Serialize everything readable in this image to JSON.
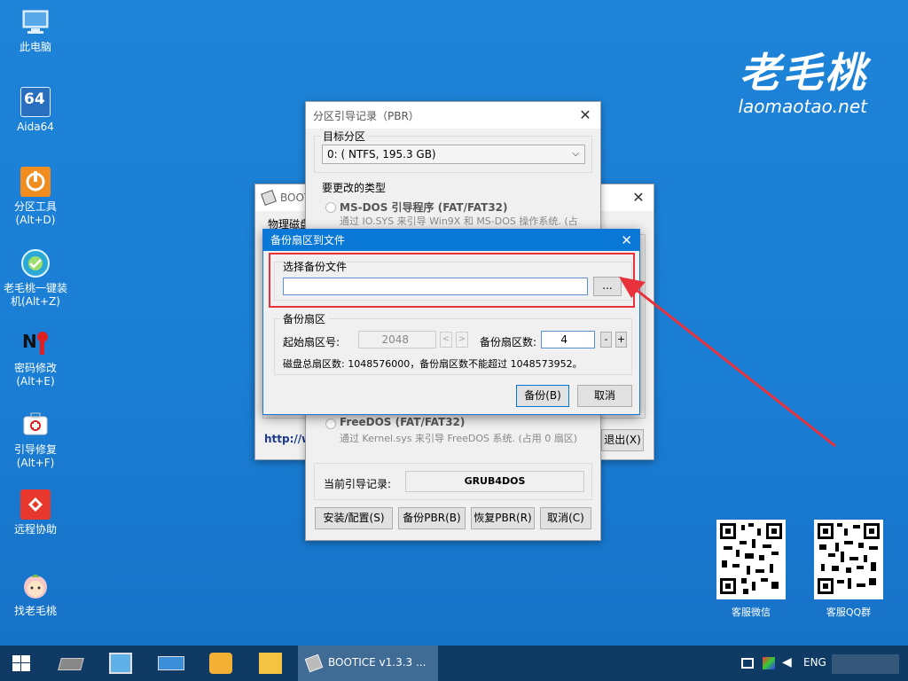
{
  "desktop": {
    "icons": [
      {
        "label": "此电脑"
      },
      {
        "label": "Aida64"
      },
      {
        "label": "分区工具\n(Alt+D)"
      },
      {
        "label": "老毛桃一键装\n机(Alt+Z)"
      },
      {
        "label": "密码修改\n(Alt+E)"
      },
      {
        "label": "引导修复\n(Alt+F)"
      },
      {
        "label": "远程协助"
      },
      {
        "label": "找老毛桃"
      }
    ],
    "aida_badge": "64",
    "brand_script": "老毛桃",
    "brand_url": "laomaotao.net",
    "qr_left_label": "客服微信",
    "qr_right_label": "客服QQ群"
  },
  "bootice_window": {
    "title": "BOOTICE v1.3.3 ...",
    "tab_label": "物理磁盘",
    "url_text": "http://w",
    "exit_label": "退出(X)"
  },
  "pbr_dialog": {
    "title": "分区引导记录（PBR）",
    "target_label": "目标分区",
    "target_value": "0: ( NTFS, 195.3 GB)",
    "type_label": "要更改的类型",
    "msdos_title": "MS-DOS 引导程序 (FAT/FAT32)",
    "msdos_desc": "通过 IO.SYS 来引导 Win9X 和 MS-DOS 操作系统. (占",
    "freedos_title": "FreeDOS (FAT/FAT32)",
    "freedos_desc": "通过 Kernel.sys 来引导 FreeDOS 系统. (占用 0 扇区)",
    "current_label": "当前引导记录:",
    "current_value": "GRUB4DOS",
    "btn_install": "安装/配置(S)",
    "btn_backup": "备份PBR(B)",
    "btn_restore": "恢复PBR(R)",
    "btn_cancel": "取消(C)"
  },
  "backup_dialog": {
    "title": "备份扇区到文件",
    "file_group": "选择备份文件",
    "file_value": "",
    "browse": "...",
    "sector_group": "备份扇区",
    "start_label": "起始扇区号:",
    "start_value": "2048",
    "count_label": "备份扇区数:",
    "count_value": "4",
    "minus": "-",
    "plus": "+",
    "info": "磁盘总扇区数: 1048576000，备份扇区数不能超过 1048573952。",
    "ok": "备份(B)",
    "cancel": "取消"
  },
  "taskbar": {
    "active_task": "BOOTICE v1.3.3 ...",
    "lang": "ENG"
  },
  "colors": {
    "annotation_red": "#e8313a",
    "accent_blue": "#0078d7",
    "taskbar": "#0e3a63"
  }
}
